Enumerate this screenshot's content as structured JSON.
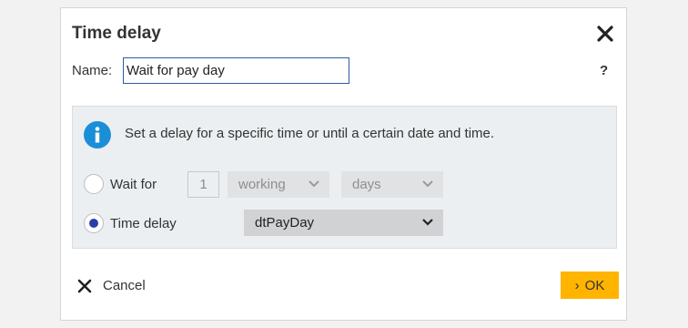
{
  "dialog": {
    "title": "Time delay",
    "name_label": "Name:",
    "name_value": "Wait for pay day",
    "help_label": "?"
  },
  "info": {
    "text": "Set a delay for a specific time or until a certain date and time.",
    "icon": "info-icon",
    "icon_color": "#1a8fd8"
  },
  "options": {
    "wait_for": {
      "label": "Wait for",
      "checked": false,
      "amount": "1",
      "unit_type": "working",
      "unit": "days"
    },
    "time_delay": {
      "label": "Time delay",
      "checked": true,
      "selected": "dtPayDay"
    }
  },
  "footer": {
    "cancel_label": "Cancel",
    "ok_label": "OK",
    "ok_prefix": "›",
    "ok_color": "#ffb400"
  }
}
